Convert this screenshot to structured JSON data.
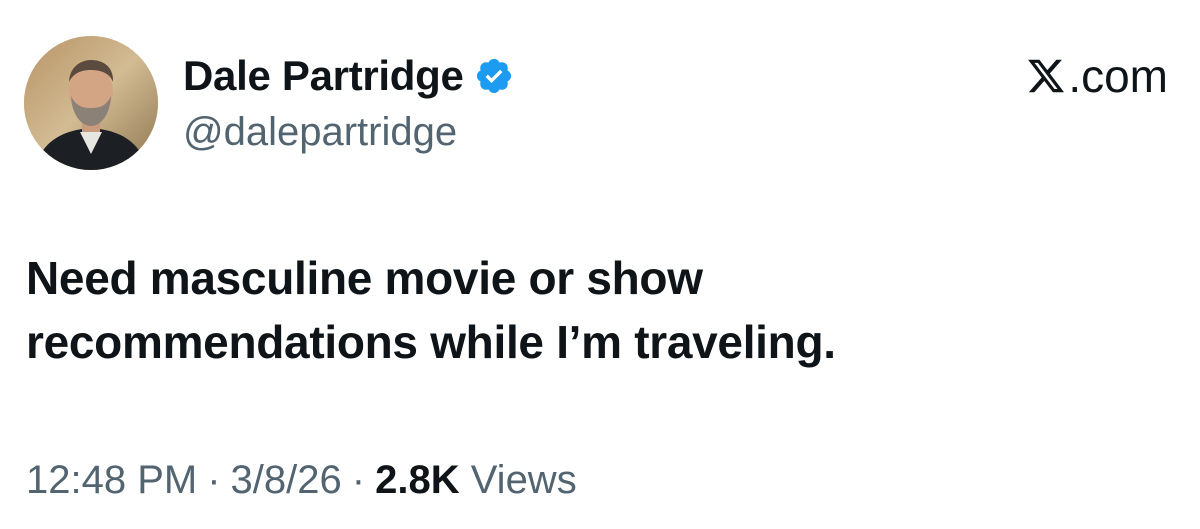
{
  "author": {
    "display_name": "Dale Partridge",
    "handle": "@dalepartridge",
    "verified": true
  },
  "brand": {
    "text": ".com"
  },
  "tweet": {
    "line1": "Need masculine movie or show",
    "line2": "recommendations while I’m traveling."
  },
  "meta": {
    "time": "12:48 PM",
    "date": "3/8/26",
    "separator": "·",
    "views_count": "2.8K",
    "views_label": "Views"
  },
  "colors": {
    "text_primary": "#0f1419",
    "text_secondary": "#536471",
    "verified_badge": "#1d9bf0"
  }
}
